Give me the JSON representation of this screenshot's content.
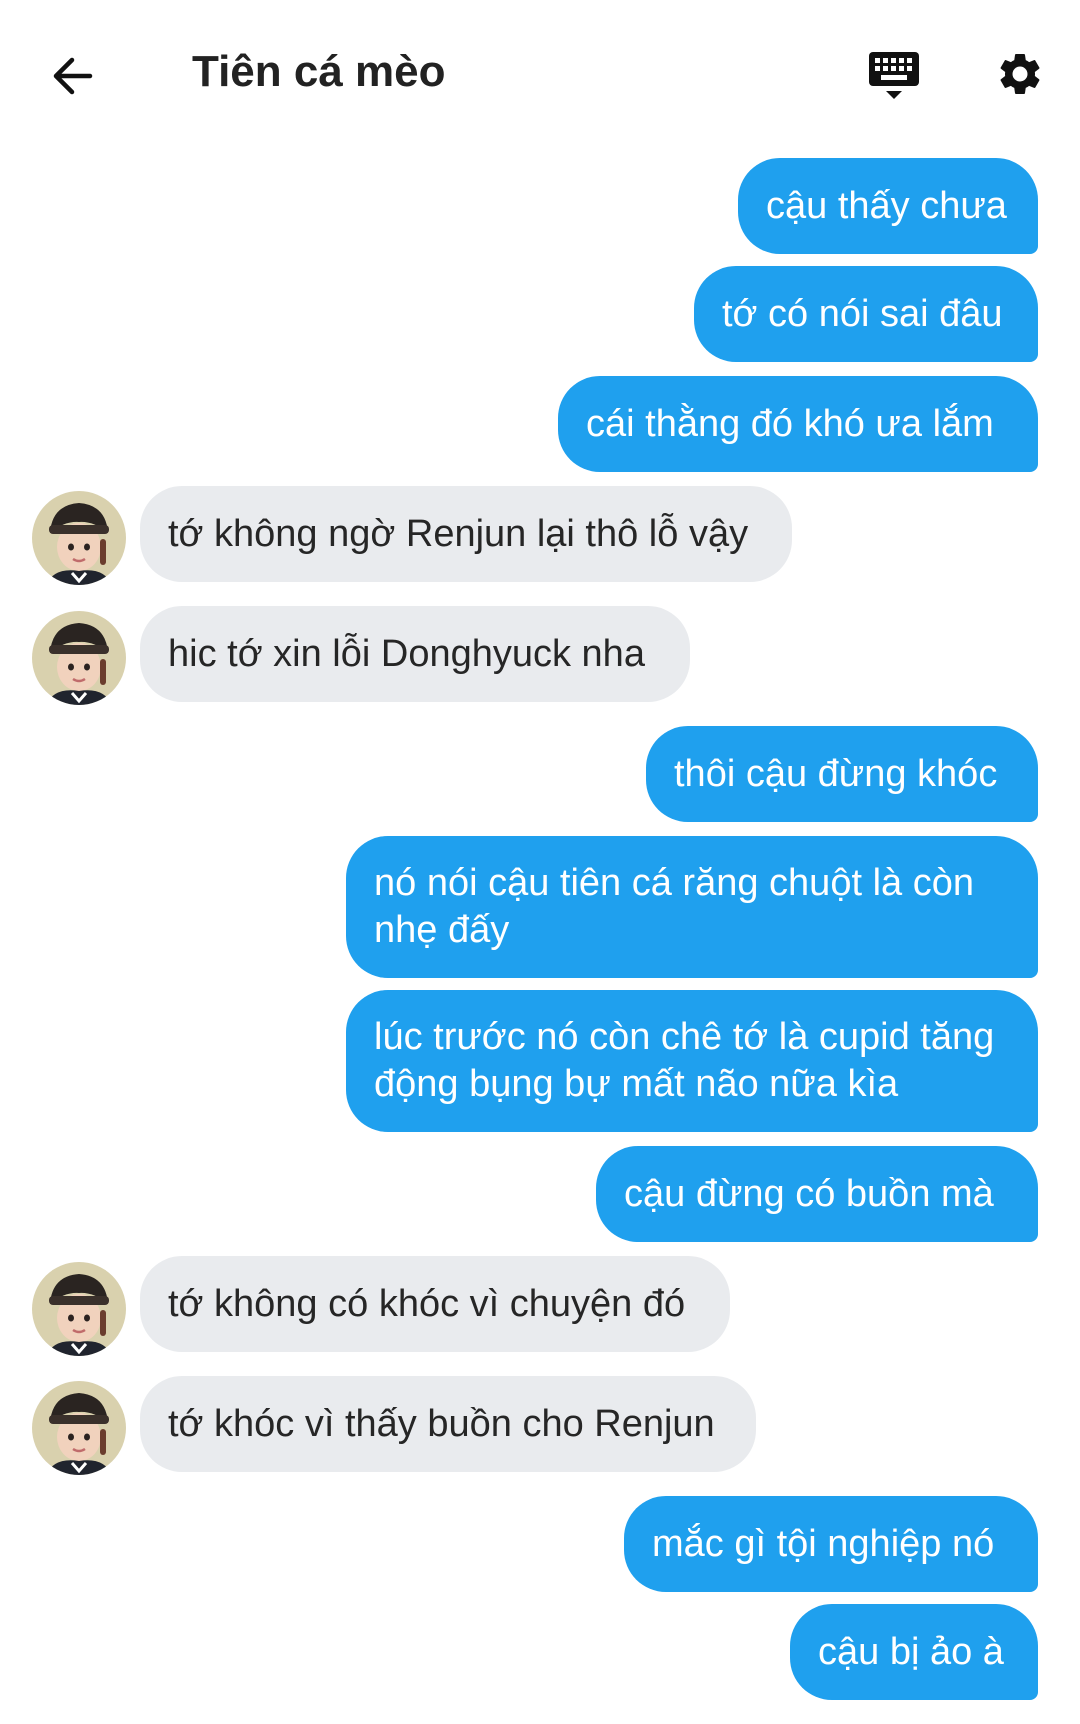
{
  "header": {
    "title": "Tiên cá mèo",
    "back_icon": "arrow-left-icon",
    "keyboard_icon": "keyboard-icon",
    "settings_icon": "gear-icon"
  },
  "colors": {
    "outgoing_bubble": "#1fa0ee",
    "incoming_bubble": "#e9ebee",
    "outgoing_text": "#ffffff",
    "incoming_text": "#262626"
  },
  "messages": [
    {
      "dir": "out",
      "text": "cậu thấy chưa"
    },
    {
      "dir": "out",
      "text": "tớ có nói sai đâu"
    },
    {
      "dir": "out",
      "text": "cái thằng đó khó ưa lắm"
    },
    {
      "dir": "in",
      "text": "tớ không ngờ Renjun lại thô lỗ vậy"
    },
    {
      "dir": "in",
      "text": "hic tớ xin lỗi Donghyuck nha"
    },
    {
      "dir": "out",
      "text": "thôi cậu đừng khóc"
    },
    {
      "dir": "out",
      "text": "nó nói cậu tiên cá răng chuột là còn nhẹ đấy"
    },
    {
      "dir": "out",
      "text": "lúc trước nó còn chê tớ là cupid tăng động bụng bự mất não nữa kìa"
    },
    {
      "dir": "out",
      "text": "cậu đừng có buồn mà"
    },
    {
      "dir": "in",
      "text": "tớ không có khóc vì chuyện đó"
    },
    {
      "dir": "in",
      "text": "tớ khóc vì thấy buồn cho Renjun"
    },
    {
      "dir": "out",
      "text": "mắc gì tội nghiệp nó"
    },
    {
      "dir": "out",
      "text": "cậu bị ảo à"
    }
  ]
}
